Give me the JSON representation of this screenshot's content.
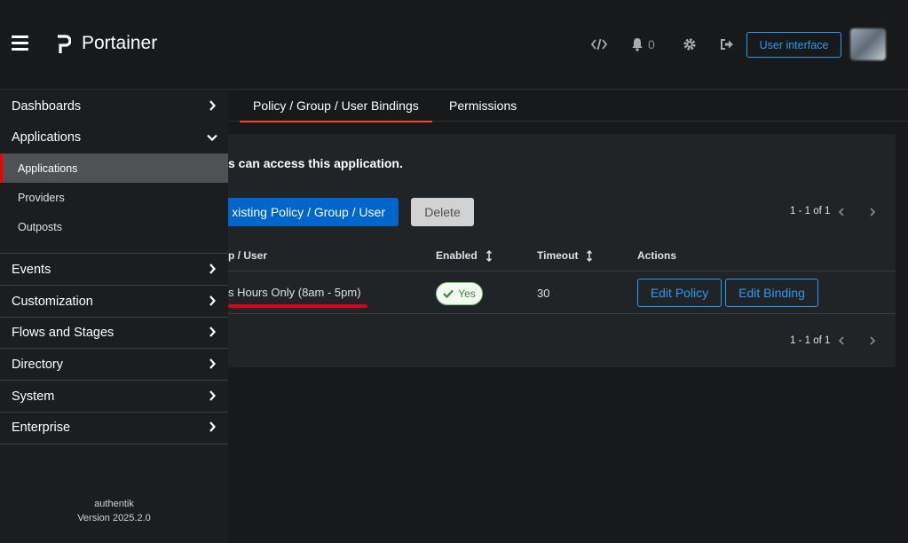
{
  "header": {
    "app_title": "Portainer",
    "notification_count": "0",
    "user_interface_label": "User interface",
    "icons": [
      "menu-icon",
      "portainer-logo",
      "code-icon",
      "bell-icon",
      "gear-icon",
      "logout-icon"
    ]
  },
  "sidebar": {
    "items": [
      {
        "label": "Dashboards"
      },
      {
        "label": "Applications"
      },
      {
        "label": "Events"
      },
      {
        "label": "Customization"
      },
      {
        "label": "Flows and Stages"
      },
      {
        "label": "Directory"
      },
      {
        "label": "System"
      },
      {
        "label": "Enterprise"
      }
    ],
    "sub_items": [
      {
        "label": "Applications",
        "active": true
      },
      {
        "label": "Providers"
      },
      {
        "label": "Outposts"
      }
    ],
    "footer": {
      "product": "authentik",
      "version": "Version 2025.2.0"
    }
  },
  "tabs": [
    {
      "label": "Policy / Group / User Bindings",
      "active": true
    },
    {
      "label": "Permissions"
    }
  ],
  "bindings": {
    "description": "s can access this application.",
    "bind_button_label": "xisting Policy / Group / User",
    "delete_button_label": "Delete",
    "pagination_top": "1 - 1 of 1",
    "pagination_bottom": "1 - 1 of 1",
    "columns": {
      "name": "p / User",
      "enabled": "Enabled",
      "timeout": "Timeout",
      "actions": "Actions"
    },
    "rows": [
      {
        "name": "s Hours Only (8am - 5pm)",
        "enabled": "Yes",
        "timeout": "30",
        "edit_policy": "Edit Policy",
        "edit_binding": "Edit Binding"
      }
    ]
  },
  "colors": {
    "accent_blue": "#0066cc",
    "link_blue": "#2b9af3",
    "active_red": "#ee0000",
    "annotation_red": "#e0001b",
    "success_green": "#3e8635"
  }
}
